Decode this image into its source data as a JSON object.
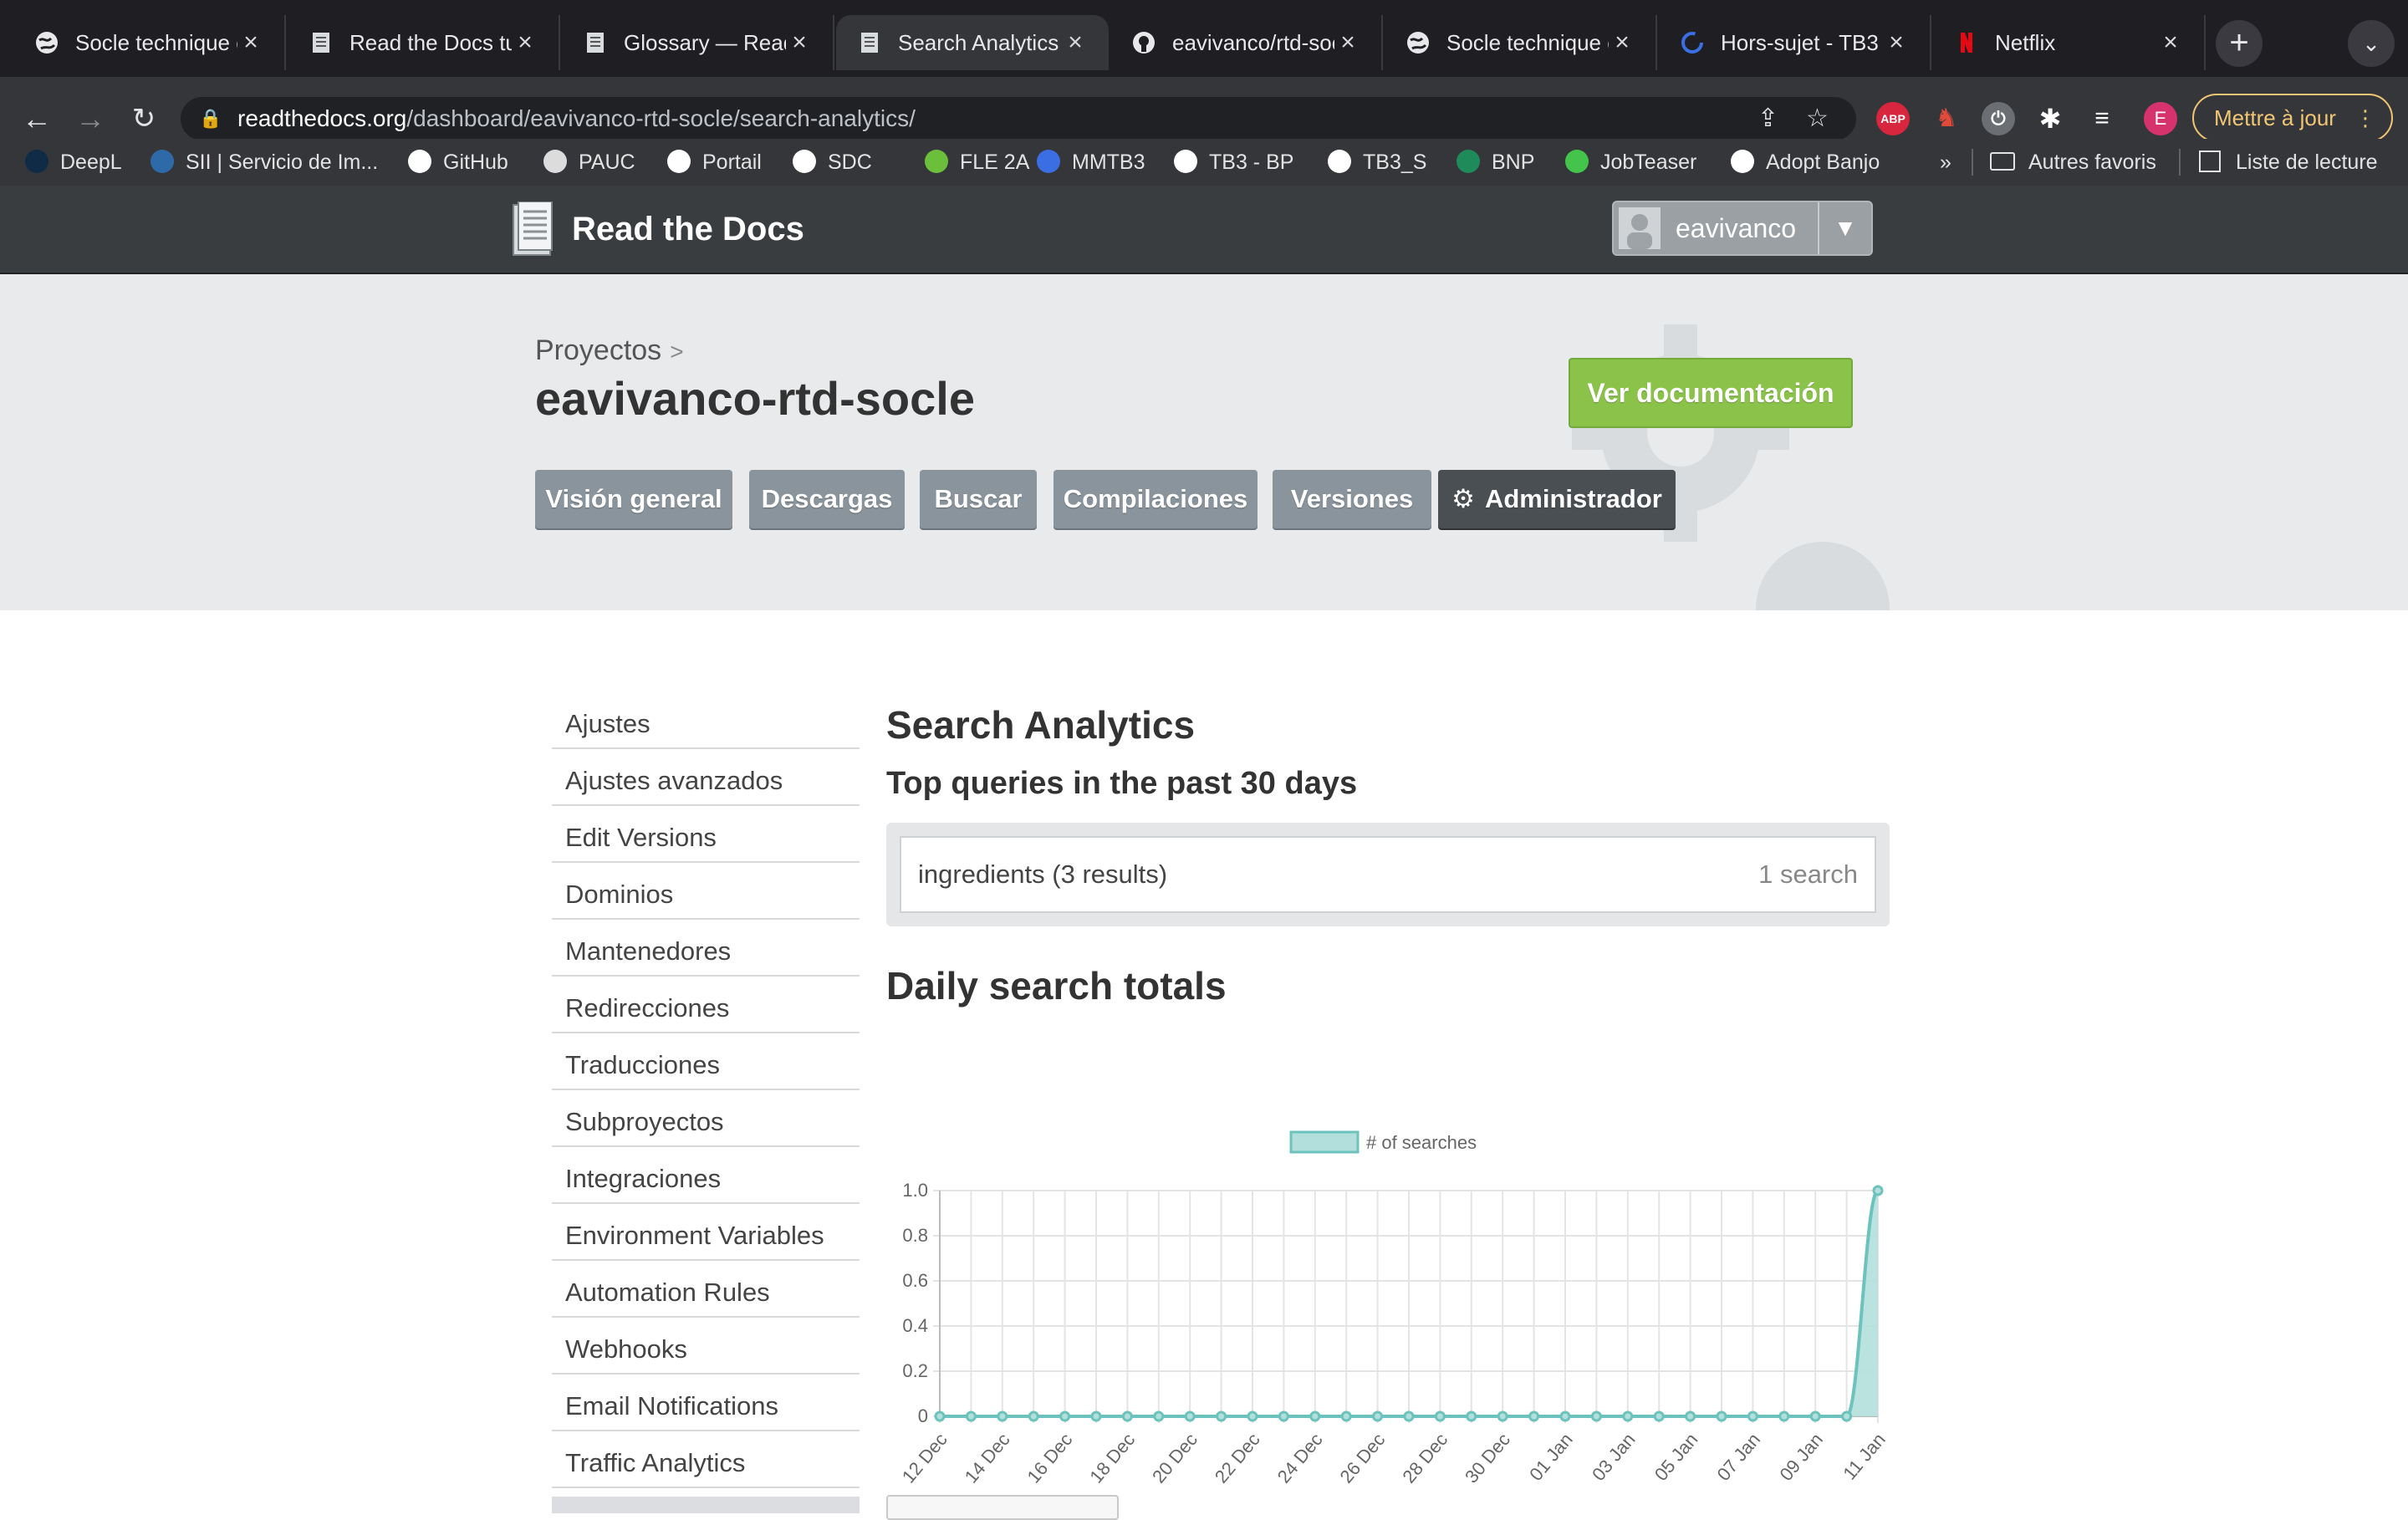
{
  "browser": {
    "tabs": [
      {
        "title": "Socle technique c",
        "icon": "globe-icon"
      },
      {
        "title": "Read the Docs tu",
        "icon": "rtd-book-icon"
      },
      {
        "title": "Glossary — Read",
        "icon": "rtd-book-icon"
      },
      {
        "title": "Search Analytics |",
        "icon": "rtd-book-icon"
      },
      {
        "title": "eavivanco/rtd-soc",
        "icon": "github-icon"
      },
      {
        "title": "Socle technique c",
        "icon": "globe-icon"
      },
      {
        "title": "Hors-sujet - TB3",
        "icon": "circle-progress-icon"
      },
      {
        "title": "Netflix",
        "icon": "netflix-icon"
      }
    ],
    "new_tab_label": "+",
    "url_host": "readthedocs.org",
    "url_path": "/dashboard/eavivanco-rtd-socle/search-analytics/",
    "update_button": "Mettre à jour",
    "profile_initial": "E",
    "extension_abp_label": "ABP",
    "bookmarks": [
      {
        "label": "DeepL",
        "color": "#0f2b46"
      },
      {
        "label": "SII | Servicio de Im...",
        "color": "#2f6aa8"
      },
      {
        "label": "GitHub",
        "color": "#ffffff"
      },
      {
        "label": "PAUC",
        "color": "#dcdcdc"
      },
      {
        "label": "Portail",
        "color": "#ffffff"
      },
      {
        "label": "SDC",
        "color": "#ffffff"
      },
      {
        "label": "FLE 2A",
        "color": "#6bbf3a"
      },
      {
        "label": "MMTB3",
        "color": "#3b6de3"
      },
      {
        "label": "TB3 - BP",
        "color": "#ffffff"
      },
      {
        "label": "TB3_S",
        "color": "#ffffff"
      },
      {
        "label": "BNP",
        "color": "#1f8a5a"
      },
      {
        "label": "JobTeaser",
        "color": "#44c44a"
      },
      {
        "label": "Adopt Banjo",
        "color": "#ffffff"
      }
    ],
    "bookmarks_overflow": "»",
    "other_bookmarks": "Autres favoris",
    "reading_list": "Liste de lecture"
  },
  "rtd": {
    "brand": "Read the Docs",
    "username": "eavivanco",
    "breadcrumb_parent": "Proyectos",
    "breadcrumb_sep": ">",
    "project_name": "eavivanco-rtd-socle",
    "docs_button": "Ver documentación",
    "project_tabs": [
      {
        "label": "Visión general",
        "active": false
      },
      {
        "label": "Descargas",
        "active": false
      },
      {
        "label": "Buscar",
        "active": false
      },
      {
        "label": "Compilaciones",
        "active": false
      },
      {
        "label": "Versiones",
        "active": false
      },
      {
        "label": "Administrador",
        "active": true
      }
    ]
  },
  "sidebar": {
    "items": [
      "Ajustes",
      "Ajustes avanzados",
      "Edit Versions",
      "Dominios",
      "Mantenedores",
      "Redirecciones",
      "Traducciones",
      "Subproyectos",
      "Integraciones",
      "Environment Variables",
      "Automation Rules",
      "Webhooks",
      "Email Notifications",
      "Traffic Analytics"
    ]
  },
  "main": {
    "title": "Search Analytics",
    "top_queries_heading": "Top queries in the past 30 days",
    "queries": [
      {
        "query": "ingredients (3 results)",
        "count": "1 search"
      }
    ],
    "daily_heading": "Daily search totals"
  },
  "chart_data": {
    "type": "area",
    "legend": [
      "# of searches"
    ],
    "legend_position": "top",
    "x": [
      "12 Dec",
      "13 Dec",
      "14 Dec",
      "15 Dec",
      "16 Dec",
      "17 Dec",
      "18 Dec",
      "19 Dec",
      "20 Dec",
      "21 Dec",
      "22 Dec",
      "23 Dec",
      "24 Dec",
      "25 Dec",
      "26 Dec",
      "27 Dec",
      "28 Dec",
      "29 Dec",
      "30 Dec",
      "31 Dec",
      "01 Jan",
      "02 Jan",
      "03 Jan",
      "04 Jan",
      "05 Jan",
      "06 Jan",
      "07 Jan",
      "08 Jan",
      "09 Jan",
      "10 Jan",
      "11 Jan"
    ],
    "x_tick_labels": [
      "12 Dec",
      "14 Dec",
      "16 Dec",
      "18 Dec",
      "20 Dec",
      "22 Dec",
      "24 Dec",
      "26 Dec",
      "28 Dec",
      "30 Dec",
      "01 Jan",
      "03 Jan",
      "05 Jan",
      "07 Jan",
      "09 Jan",
      "11 Jan"
    ],
    "series": [
      {
        "name": "# of searches",
        "values": [
          0,
          0,
          0,
          0,
          0,
          0,
          0,
          0,
          0,
          0,
          0,
          0,
          0,
          0,
          0,
          0,
          0,
          0,
          0,
          0,
          0,
          0,
          0,
          0,
          0,
          0,
          0,
          0,
          0,
          0,
          1
        ]
      }
    ],
    "y_ticks": [
      "0",
      "0.2",
      "0.4",
      "0.6",
      "0.8",
      "1.0"
    ],
    "ylim": [
      0,
      1
    ],
    "grid": true,
    "colors": {
      "line": "#6cc3bd",
      "fill": "#b2dfdc"
    }
  }
}
